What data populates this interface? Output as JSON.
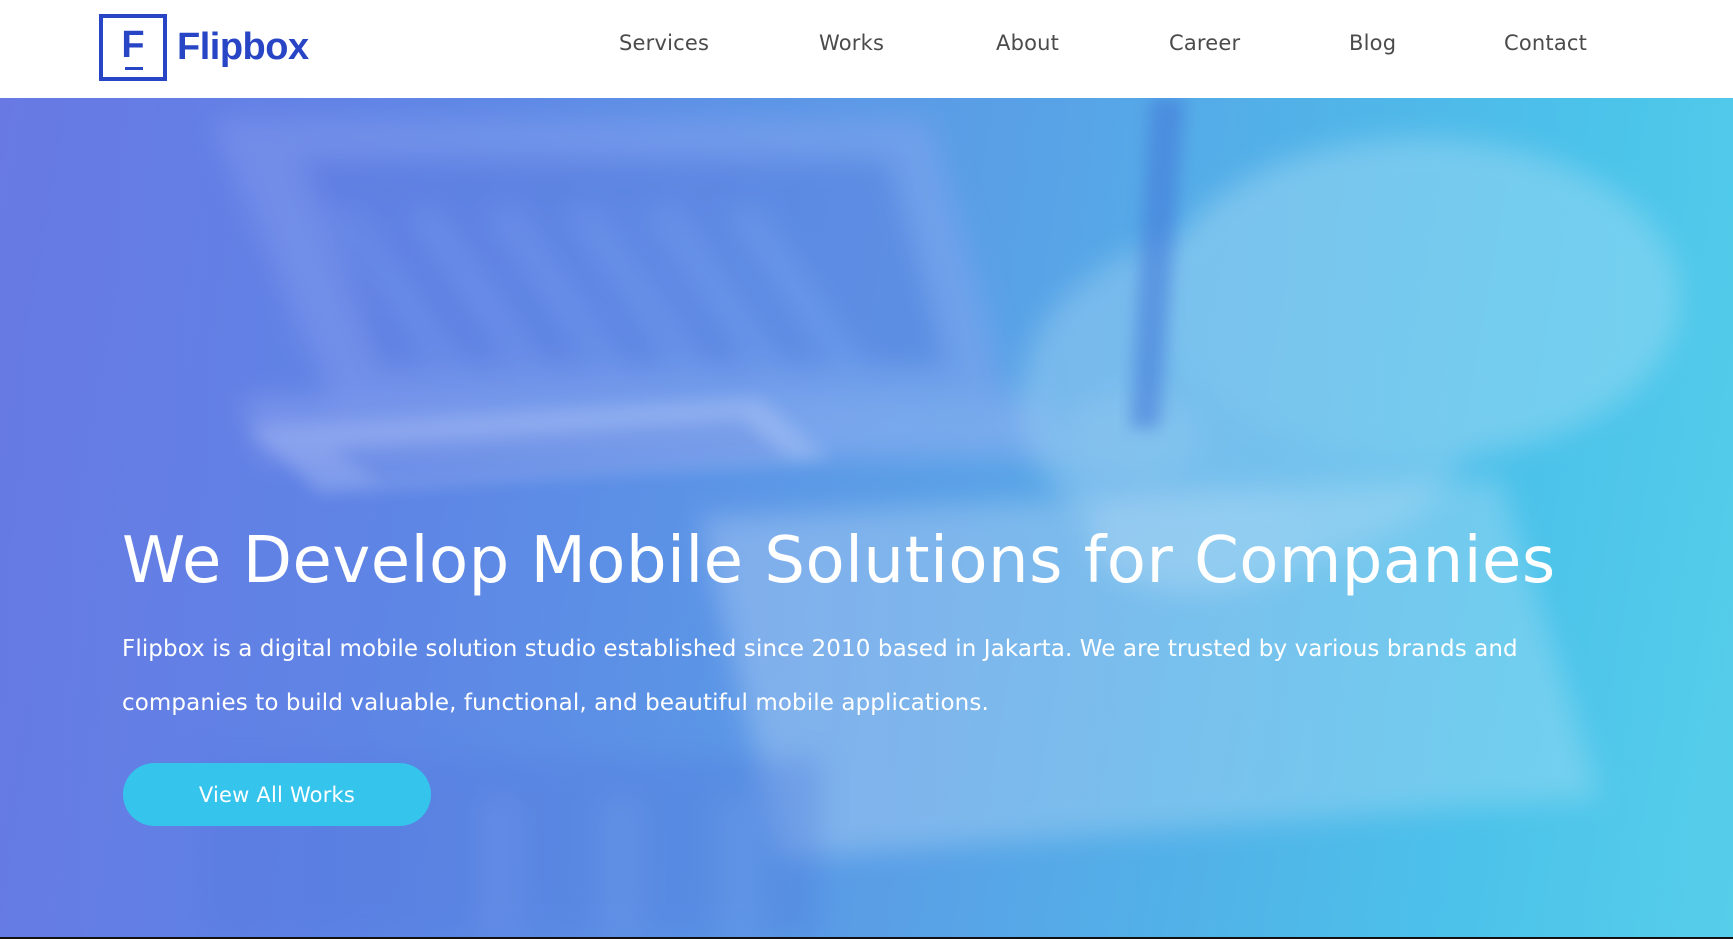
{
  "brand": {
    "logo_letter": "F",
    "name": "Flipbox",
    "color": "#2845c6"
  },
  "nav": {
    "services": "Services",
    "works": "Works",
    "about": "About",
    "career": "Career",
    "blog": "Blog",
    "contact": "Contact"
  },
  "hero": {
    "title": "We Develop Mobile Solutions for Companies",
    "subtitle": "Flipbox is a digital mobile solution studio established since 2010 based in Jakarta. We are trusted by various brands and companies to build valuable, functional, and beautiful mobile applications.",
    "button_label": "View All Works",
    "background": "photo-laptop-hand-writing",
    "gradient_start": "#6a7fe6",
    "gradient_end": "#4cc3ea",
    "button_color": "#35c4ec"
  }
}
